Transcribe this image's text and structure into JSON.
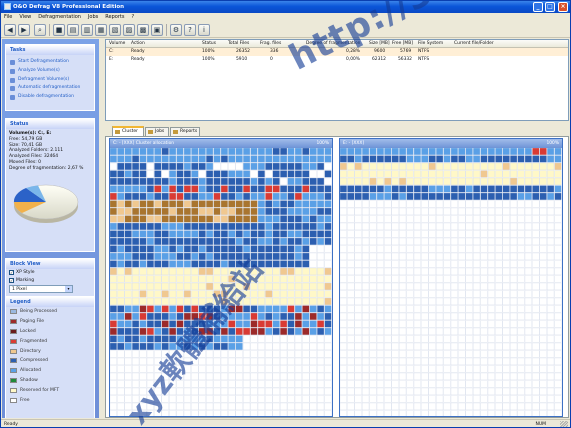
{
  "window": {
    "title": "O&O Defrag V8 Professional Edition",
    "min": "_",
    "max": "□",
    "close": "×"
  },
  "menu": [
    "File",
    "View",
    "Defragmentation",
    "Jobs",
    "Reports",
    "?"
  ],
  "toolbar": {
    "icons": [
      "back-icon",
      "forward-icon",
      "analyze-icon",
      "stop-icon",
      "defrag-stealth-icon",
      "defrag-space-icon",
      "defrag-complete-name-icon",
      "defrag-complete-modified-icon",
      "defrag-complete-access-icon",
      "job-icon",
      "report-icon",
      "settings-icon",
      "help-icon",
      "info-icon"
    ]
  },
  "tasks": {
    "header": "Tasks",
    "items": [
      "Start Defragmentation",
      "Analyze Volume(s)",
      "Defragment Volume(s)",
      "Automatic defragmentation",
      "Disable defragmentation"
    ]
  },
  "status": {
    "header": "Status",
    "volume": "Volume(s): C:, E:",
    "lines": [
      "Free: 54,79 GB",
      "Size: 70,41 GB",
      "Analyzed Folders: 2.111",
      "Analyzed Files: 32464",
      "Moved Files: 0",
      "Degree of fragmentation: 2,67 %"
    ]
  },
  "blockview": {
    "header": "Block View",
    "xp_style": "XP Style",
    "marking": "Marking",
    "checked": "✓",
    "pixel": "1 Pixel",
    "arrow": "▾"
  },
  "legend": {
    "header": "Legend",
    "items": [
      {
        "label": "Being Processed",
        "color": "#9ab8e0"
      },
      {
        "label": "Paging File",
        "color": "#9c2a2a"
      },
      {
        "label": "Locked",
        "color": "#6a1d1d"
      },
      {
        "label": "Fragmented",
        "color": "#d93b34"
      },
      {
        "label": "Directory",
        "color": "#f0c890"
      },
      {
        "label": "Compressed",
        "color": "#2c5fb0"
      },
      {
        "label": "Allocated",
        "color": "#5aa0e6"
      },
      {
        "label": "Shadow",
        "color": "#1f8a3a"
      },
      {
        "label": "Reserved for MFT",
        "color": "#fff8c8"
      },
      {
        "label": "Free",
        "color": "#ffffff"
      }
    ]
  },
  "list": {
    "columns": [
      "Volume",
      "Action",
      "Status",
      "Total Files",
      "Frag. files",
      "Degree of fragmentation",
      "Size [MB]",
      "Free [MB]",
      "File System",
      "Current file/Folder"
    ],
    "rows": [
      {
        "volume": "C:",
        "action": "Ready",
        "status": "100%",
        "total": "26352",
        "frag": "336",
        "degree": "0,28%",
        "size": "9600",
        "free": "5769",
        "fs": "NTFS",
        "current": ""
      },
      {
        "volume": "E:",
        "action": "Ready",
        "status": "100%",
        "total": "5910",
        "frag": "0",
        "degree": "0,00%",
        "size": "62312",
        "free": "56332",
        "fs": "NTFS",
        "current": ""
      }
    ]
  },
  "tabs": [
    "Cluster",
    "Jobs",
    "Reports"
  ],
  "maps": [
    {
      "title": "C: - [XXX] Cluster allocation",
      "percent": "100%"
    },
    {
      "title": "E: - [XXX]",
      "percent": "100%"
    }
  ],
  "statusbar": {
    "left": "Ready",
    "right": "NUM"
  },
  "watermark": {
    "url": "http://31.to",
    "cjk": "xyz軟體補給站"
  }
}
